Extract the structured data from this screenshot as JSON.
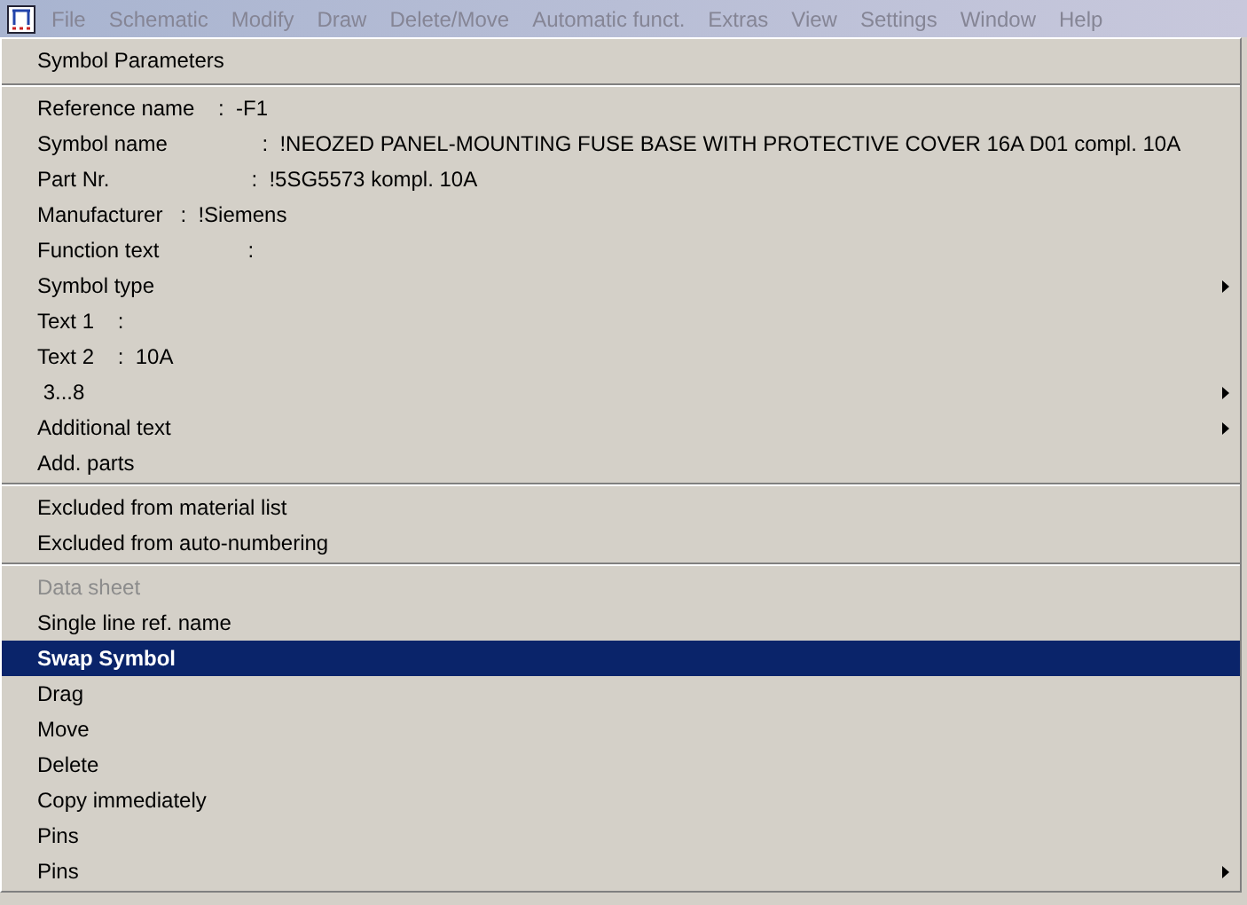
{
  "menubar": [
    {
      "label": "File"
    },
    {
      "label": "Schematic"
    },
    {
      "label": "Modify"
    },
    {
      "label": "Draw"
    },
    {
      "label": "Delete/Move"
    },
    {
      "label": "Automatic funct."
    },
    {
      "label": "Extras"
    },
    {
      "label": "View"
    },
    {
      "label": "Settings"
    },
    {
      "label": "Window"
    },
    {
      "label": "Help"
    }
  ],
  "menu": {
    "sections": [
      [
        {
          "text": "Symbol Parameters",
          "disabled": false,
          "selected": false,
          "submenu": false
        }
      ],
      [
        {
          "text": "Reference name    :  -F1",
          "disabled": false,
          "selected": false,
          "submenu": false
        },
        {
          "text": "Symbol name                :  !NEOZED PANEL-MOUNTING FUSE BASE WITH PROTECTIVE COVER 16A D01 compl. 10A",
          "disabled": false,
          "selected": false,
          "submenu": false
        },
        {
          "text": "Part Nr.                        :  !5SG5573 kompl. 10A",
          "disabled": false,
          "selected": false,
          "submenu": false
        },
        {
          "text": "Manufacturer   :  !Siemens",
          "disabled": false,
          "selected": false,
          "submenu": false
        },
        {
          "text": "Function text               :",
          "disabled": false,
          "selected": false,
          "submenu": false
        },
        {
          "text": "Symbol type",
          "disabled": false,
          "selected": false,
          "submenu": true
        },
        {
          "text": "Text 1    :",
          "disabled": false,
          "selected": false,
          "submenu": false
        },
        {
          "text": "Text 2    :  10A",
          "disabled": false,
          "selected": false,
          "submenu": false
        },
        {
          "text": " 3...8",
          "disabled": false,
          "selected": false,
          "submenu": true
        },
        {
          "text": "Additional text",
          "disabled": false,
          "selected": false,
          "submenu": true
        },
        {
          "text": "Add. parts",
          "disabled": false,
          "selected": false,
          "submenu": false
        }
      ],
      [
        {
          "text": "Excluded from material list",
          "disabled": false,
          "selected": false,
          "submenu": false
        },
        {
          "text": "Excluded from auto-numbering",
          "disabled": false,
          "selected": false,
          "submenu": false
        }
      ],
      [
        {
          "text": "Data sheet",
          "disabled": true,
          "selected": false,
          "submenu": false
        },
        {
          "text": "Single line ref. name",
          "disabled": false,
          "selected": false,
          "submenu": false
        },
        {
          "text": "Swap Symbol",
          "disabled": false,
          "selected": true,
          "submenu": false
        },
        {
          "text": "Drag",
          "disabled": false,
          "selected": false,
          "submenu": false
        },
        {
          "text": "Move",
          "disabled": false,
          "selected": false,
          "submenu": false
        },
        {
          "text": "Delete",
          "disabled": false,
          "selected": false,
          "submenu": false
        },
        {
          "text": "Copy immediately",
          "disabled": false,
          "selected": false,
          "submenu": false
        },
        {
          "text": "Pins",
          "disabled": false,
          "selected": false,
          "submenu": false
        },
        {
          "text": "Pins",
          "disabled": false,
          "selected": false,
          "submenu": true
        }
      ]
    ]
  }
}
